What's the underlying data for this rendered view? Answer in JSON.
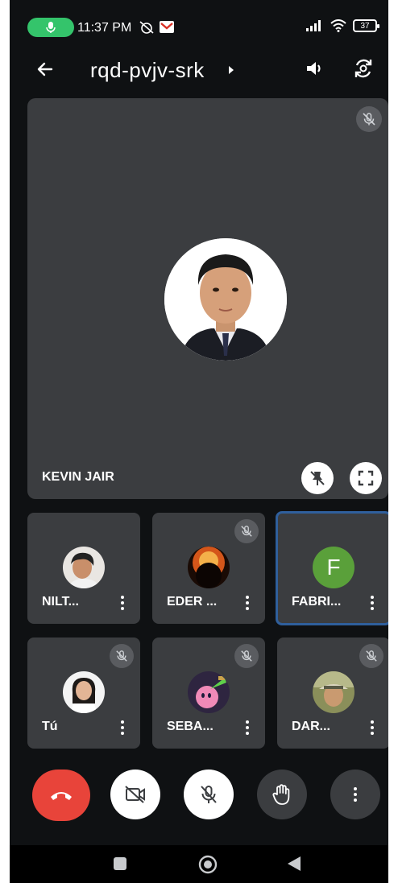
{
  "status_bar": {
    "time": "11:37 PM",
    "battery": "37"
  },
  "meeting": {
    "code": "rqd-pvjv-srk"
  },
  "main_tile": {
    "name": "KEVIN JAIR"
  },
  "participants": [
    {
      "name": "NILT..."
    },
    {
      "name": "EDER ..."
    },
    {
      "name": "FABRI...",
      "initial": "F"
    },
    {
      "name": "Tú"
    },
    {
      "name": "SEBA..."
    },
    {
      "name": "DAR..."
    }
  ],
  "colors": {
    "background": "#0f1113",
    "tile": "#3b3d40",
    "end_call": "#e8443a",
    "active_border": "#2f5f9c",
    "mic_pill": "#34c46b",
    "avatar_f": "#5aa03a"
  },
  "icons": [
    "microphone-icon",
    "back-arrow-icon",
    "caret-right-icon",
    "speaker-icon",
    "switch-camera-icon",
    "mic-off-icon",
    "pin-off-icon",
    "fullscreen-icon",
    "more-vert-icon",
    "end-call-icon",
    "video-off-icon",
    "raise-hand-icon",
    "nav-recents-icon",
    "nav-home-icon",
    "nav-back-icon"
  ]
}
